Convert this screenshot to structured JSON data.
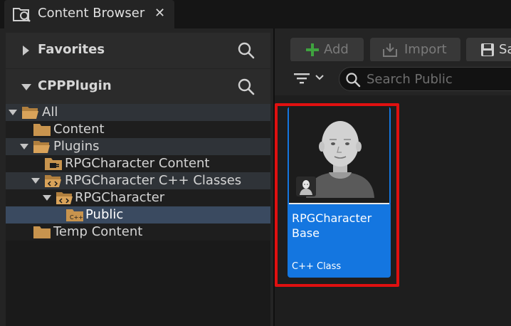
{
  "tab": {
    "title": "Content Browser",
    "close": "✕",
    "icon": "content-browser-icon"
  },
  "sources": {
    "favorites": {
      "label": "Favorites",
      "expanded": false
    },
    "project": {
      "label": "CPPPlugin",
      "expanded": true
    }
  },
  "tree": [
    {
      "label": "All",
      "expanded": true,
      "icon": "folder-open-icon"
    },
    {
      "label": "Content",
      "icon": "folder-icon"
    },
    {
      "label": "Plugins",
      "expanded": true,
      "icon": "folder-open-icon"
    },
    {
      "label": "RPGCharacter Content",
      "icon": "plugin-folder-icon"
    },
    {
      "label": "RPGCharacter C++ Classes",
      "expanded": true,
      "icon": "code-folder-open-icon"
    },
    {
      "label": "RPGCharacter",
      "expanded": true,
      "icon": "code-folder-open-icon"
    },
    {
      "label": "Public",
      "selected": true,
      "icon": "cpp-folder-icon"
    },
    {
      "label": "Temp Content",
      "icon": "folder-icon"
    }
  ],
  "toolbar": {
    "add": "Add",
    "import": "Import",
    "save": "Sa"
  },
  "search": {
    "placeholder": "Search Public",
    "value": ""
  },
  "asset": {
    "name": "RPGCharacter Base",
    "type": "C++ Class",
    "thumbnail": "character-bust-icon"
  },
  "colors": {
    "selection": "#1476e0",
    "highlight": "#e01010",
    "folder": "#c8944e"
  }
}
